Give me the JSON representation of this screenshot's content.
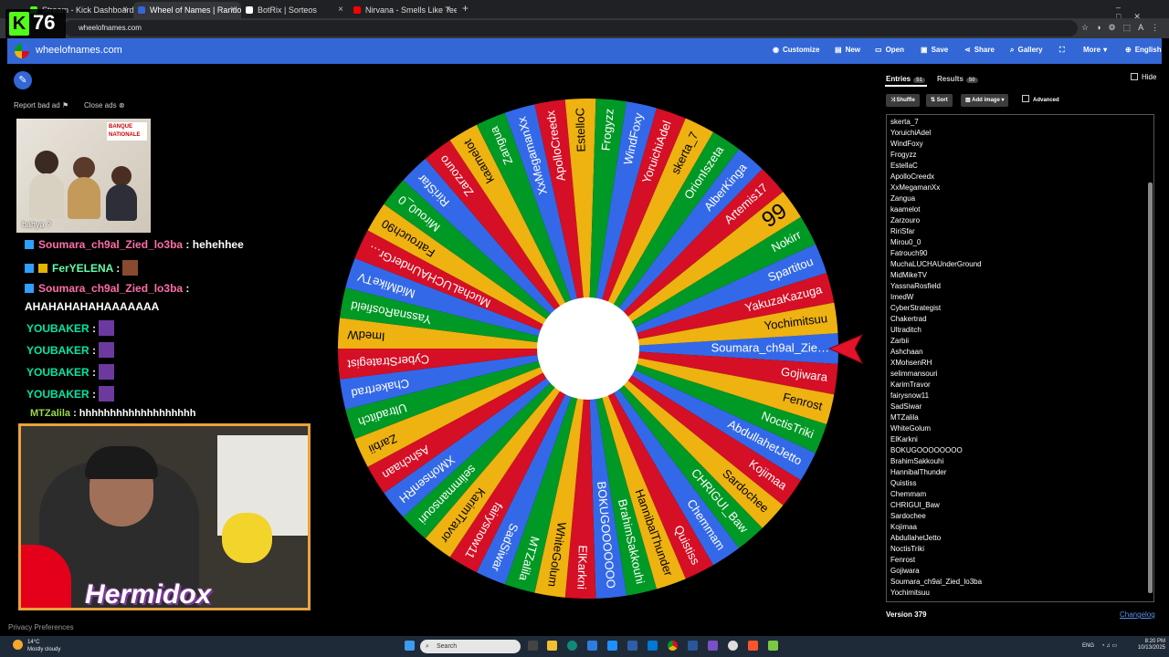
{
  "browser": {
    "tabs": [
      {
        "label": "Stream - Kick Dashboard",
        "color": "#53fc18"
      },
      {
        "label": "Wheel of Names | Random name",
        "color": "#3367d6"
      },
      {
        "label": "BotRix | Sorteos",
        "color": "#ffffff"
      },
      {
        "label": "Nirvana - Smells Like Teen Spirit",
        "color": "#ff0000"
      }
    ],
    "url": "wheelofnames.com"
  },
  "kick_overlay": {
    "logo": "K",
    "count": "76"
  },
  "site": {
    "name": "wheelofnames.com",
    "nav": [
      {
        "label": "Customize",
        "icon": "palette-icon"
      },
      {
        "label": "New",
        "icon": "document-icon"
      },
      {
        "label": "Open",
        "icon": "folder-icon"
      },
      {
        "label": "Save",
        "icon": "save-icon"
      },
      {
        "label": "Share",
        "icon": "share-icon"
      },
      {
        "label": "Gallery",
        "icon": "search-icon"
      },
      {
        "label": "",
        "icon": "fullscreen-icon"
      },
      {
        "label": "More",
        "icon": "chevron-down-icon"
      },
      {
        "label": "English",
        "icon": "globe-icon"
      }
    ]
  },
  "ads": {
    "report": "Report bad ad",
    "close": "Close ads",
    "brand": "BANQUE NATIONALE",
    "caption": "bahya ?"
  },
  "chat": [
    {
      "user": "Soumara_ch9al_Zied_lo3ba",
      "msg": " : hehehhee",
      "color": "u"
    },
    {
      "user": "FerYELENA",
      "msg": " :",
      "color": "g"
    },
    {
      "user": "Soumara_ch9al_Zied_lo3ba",
      "msg": " :",
      "color": "u"
    },
    {
      "user": "",
      "msg": "AHAHAHAHAHAAAAAAA",
      "color": "msg"
    },
    {
      "user": "YOUBAKER",
      "msg": " :",
      "color": "y"
    },
    {
      "user": "YOUBAKER",
      "msg": " :",
      "color": "y"
    },
    {
      "user": "YOUBAKER",
      "msg": " :",
      "color": "y"
    },
    {
      "user": "YOUBAKER",
      "msg": " :",
      "color": "y"
    },
    {
      "user": "MTZalila",
      "msg": " : hhhhhhhhhhhhhhhhhhh",
      "color": "g"
    }
  ],
  "webcam": {
    "name": "Hermidox"
  },
  "privacy": "Privacy Preferences",
  "wheel": {
    "colors": [
      "#3369e8",
      "#d50f25",
      "#eeb211",
      "#009925"
    ],
    "labels": [
      "Soumara_ch9al_Zie…",
      "Gojiwara",
      "Fenrost",
      "NoctisTriki",
      "AbdullahetJetto",
      "Kojimaa",
      "Sardochee",
      "CHRIGUI_Baw",
      "Chemmam",
      "Quistiss",
      "HannibalThunder",
      "BrahimSakkouhi",
      "BOKUGOOOOOOO",
      "ElKarkni",
      "WhiteGolum",
      "MTZalila",
      "SadSiwar",
      "fairysnow11",
      "KarimTravor",
      "selimmansouri",
      "XMohsenRH",
      "Ashchaan",
      "Zarbii",
      "Ultraditch",
      "Chakertrad",
      "CyberStrategist",
      "ImedW",
      "YassnaRosfield",
      "MidMikeTV",
      "MuchaLUCHAUnderGr…",
      "Fatrouch90",
      "Mirou0_0",
      "RiriSfar",
      "Zarzouro",
      "kaamelot",
      "Zangua",
      "XxMegamanXx",
      "ApolloCreedx",
      "EstelloC",
      "Frogyzz",
      "WindFoxy",
      "YoruichiAdel",
      "skerta_7",
      "OrionIszeta",
      "AlberKinga",
      "Artemis17",
      "99",
      "Nokirr",
      "Spartitou",
      "YakuzaKazuga",
      "Yochimitsuu"
    ]
  },
  "panel": {
    "entries_tab": "Entries",
    "entries_count": "51",
    "results_tab": "Results",
    "results_count": "50",
    "hide": "Hide",
    "shuffle": "Shuffle",
    "sort": "Sort",
    "add_image": "Add image",
    "advanced": "Advanced",
    "entries": [
      "skerta_7",
      "YoruichiAdel",
      "WindFoxy",
      "Frogyzz",
      "EstellaC",
      "ApolloCreedx",
      "XxMegamanXx",
      "Zangua",
      "kaamelot",
      "Zarzouro",
      "RiriSfar",
      "Mirou0_0",
      "Fatrouch90",
      "MuchaLUCHAUnderGround",
      "MidMikeTV",
      "YassnaRosfield",
      "ImedW",
      "CyberStrategist",
      "Chakertrad",
      "Ultraditch",
      "Zarbii",
      "Ashchaan",
      "XMohsenRH",
      "selimmansouri",
      "KarimTravor",
      "fairysnow11",
      "SadSiwar",
      "MTZalila",
      "WhiteGolum",
      "ElKarkni",
      "BOKUGOOOOOOOO",
      "BrahimSakkouhi",
      "HannibalThunder",
      "Quistiss",
      "Chemmam",
      "CHRIGUI_Baw",
      "Sardochee",
      "Kojimaa",
      "AbdullahetJetto",
      "NoctisTriki",
      "Fenrost",
      "Gojiwara",
      "Soumara_ch9al_Zied_lo3ba",
      "Yochimitsuu"
    ],
    "version": "Version 379",
    "changelog": "Changelog"
  },
  "taskbar": {
    "temp": "14°C",
    "weather": "Mostly cloudy",
    "search": "Search",
    "lang": "ENG",
    "time": "8:20 PM",
    "date": "10/13/2025"
  }
}
